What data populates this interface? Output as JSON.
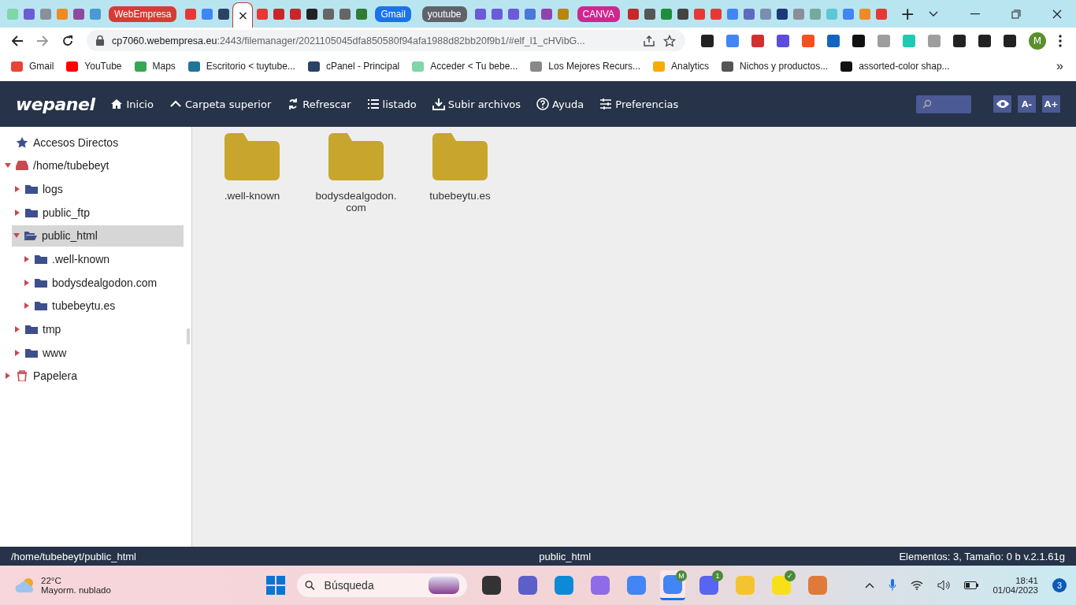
{
  "browser": {
    "tabs": [
      {
        "kind": "icon",
        "color": "#7fd6a6",
        "selected": false
      },
      {
        "kind": "icon",
        "color": "#6b5bd6",
        "selected": false
      },
      {
        "kind": "icon",
        "color": "#8a8f99",
        "selected": false
      },
      {
        "kind": "icon",
        "color": "#f08a24",
        "selected": false
      },
      {
        "kind": "icon",
        "color": "#8e4a9e",
        "selected": false
      },
      {
        "kind": "icon",
        "color": "#4a9ad6",
        "selected": false
      },
      {
        "kind": "label",
        "label": "WebEmpresa",
        "color": "#d93a35",
        "selected": false
      },
      {
        "kind": "icon",
        "color": "#e53935",
        "selected": false
      },
      {
        "kind": "icon",
        "color": "#4285f4",
        "selected": false
      },
      {
        "kind": "icon",
        "color": "#2b4266",
        "selected": false
      },
      {
        "kind": "close",
        "label": "×",
        "color": "#ffffff",
        "selected": true
      },
      {
        "kind": "icon",
        "color": "#e53935",
        "selected": false
      },
      {
        "kind": "icon",
        "color": "#c62828",
        "selected": false
      },
      {
        "kind": "icon",
        "color": "#c62828",
        "selected": false
      },
      {
        "kind": "icon",
        "color": "#222222",
        "selected": false
      },
      {
        "kind": "icon",
        "color": "#666666",
        "selected": false
      },
      {
        "kind": "icon",
        "color": "#666666",
        "selected": false
      },
      {
        "kind": "icon",
        "color": "#2e7d32",
        "selected": false
      },
      {
        "kind": "label",
        "label": "Gmail",
        "color": "#1a73e8",
        "selected": false
      },
      {
        "kind": "label",
        "label": "youtube",
        "color": "#5f6368",
        "selected": false
      },
      {
        "kind": "icon",
        "color": "#6b5bd6",
        "selected": false
      },
      {
        "kind": "icon",
        "color": "#6b5bd6",
        "selected": false
      },
      {
        "kind": "icon",
        "color": "#6b5bd6",
        "selected": false
      },
      {
        "kind": "icon",
        "color": "#4a78d6",
        "selected": false
      },
      {
        "kind": "icon",
        "color": "#8e44ad",
        "selected": false
      },
      {
        "kind": "icon",
        "color": "#b8860b",
        "selected": false
      },
      {
        "kind": "label",
        "label": "CANVA",
        "color": "#d0268f",
        "selected": false
      },
      {
        "kind": "icon",
        "color": "#c62828",
        "selected": false
      },
      {
        "kind": "icon",
        "color": "#555555",
        "selected": false
      },
      {
        "kind": "icon",
        "color": "#1e8e3e",
        "selected": false
      },
      {
        "kind": "icon",
        "color": "#444444",
        "selected": false
      },
      {
        "kind": "icon",
        "color": "#e53935",
        "selected": false
      },
      {
        "kind": "icon",
        "color": "#e53935",
        "selected": false
      },
      {
        "kind": "icon",
        "color": "#4285f4",
        "selected": false
      },
      {
        "kind": "icon",
        "color": "#5c6bc0",
        "selected": false
      },
      {
        "kind": "icon",
        "color": "#7a8fb0",
        "selected": false
      },
      {
        "kind": "icon",
        "color": "#1a3a7a",
        "selected": false
      },
      {
        "kind": "icon",
        "color": "#8a8f99",
        "selected": false
      },
      {
        "kind": "icon",
        "color": "#74aa9c",
        "selected": false
      },
      {
        "kind": "icon",
        "color": "#5cc8d6",
        "selected": false
      },
      {
        "kind": "icon",
        "color": "#4285f4",
        "selected": false
      },
      {
        "kind": "icon",
        "color": "#f08a24",
        "selected": false
      },
      {
        "kind": "icon",
        "color": "#e53935",
        "selected": false
      }
    ],
    "new_tab": "+",
    "address": {
      "host": "cp7060.webempresa.eu",
      "path": ":2443/filemanager/2021105045dfa850580f94afa1988d82bb20f9b1/#elf_l1_cHVibG..."
    },
    "extensions": [
      {
        "color": "#222222"
      },
      {
        "color": "#4285f4"
      },
      {
        "color": "#d32f2f"
      },
      {
        "color": "#5c4de0"
      },
      {
        "color": "#f4511e"
      },
      {
        "color": "#1565c0"
      },
      {
        "color": "#111111"
      },
      {
        "color": "#9e9e9e"
      },
      {
        "color": "#1ecbb0"
      },
      {
        "color": "#9e9e9e"
      },
      {
        "color": "#222222"
      },
      {
        "color": "#222222"
      },
      {
        "color": "#222222"
      }
    ],
    "profile": "M",
    "bookmarks": [
      {
        "label": "Gmail",
        "color": "#ea4335"
      },
      {
        "label": "YouTube",
        "color": "#ff0000"
      },
      {
        "label": "Maps",
        "color": "#34a853"
      },
      {
        "label": "Escritorio < tuytube...",
        "color": "#21759b"
      },
      {
        "label": "cPanel - Principal",
        "color": "#2b4266"
      },
      {
        "label": "Acceder < Tu bebe...",
        "color": "#7fd6a6"
      },
      {
        "label": "Los Mejores Recurs...",
        "color": "#888888"
      },
      {
        "label": "Analytics",
        "color": "#f9ab00"
      },
      {
        "label": "Nichos y productos...",
        "color": "#555555"
      },
      {
        "label": "assorted-color shap...",
        "color": "#111111"
      }
    ],
    "bookmarks_more": "»"
  },
  "app": {
    "logo": "wepanel",
    "toolbar": [
      {
        "kind": "home",
        "label": "Inicio"
      },
      {
        "kind": "up",
        "label": "Carpeta superior"
      },
      {
        "kind": "refresh",
        "label": "Refrescar"
      },
      {
        "kind": "list",
        "label": "listado"
      },
      {
        "kind": "upload",
        "label": "Subir archivos"
      },
      {
        "kind": "help",
        "label": "Ayuda"
      },
      {
        "kind": "prefs",
        "label": "Preferencias"
      }
    ],
    "font_buttons": [
      "A-",
      "A+"
    ],
    "tree": [
      {
        "kind": "star",
        "label": "Accesos Directos",
        "selected": false
      },
      {
        "kind": "drive",
        "label": "/home/tubebeyt",
        "expanded": true,
        "selected": false,
        "children": [
          {
            "kind": "folder",
            "label": "logs",
            "expanded": false,
            "selected": false
          },
          {
            "kind": "folder",
            "label": "public_ftp",
            "expanded": false,
            "selected": false
          },
          {
            "kind": "folder",
            "label": "public_html",
            "expanded": true,
            "selected": true,
            "children": [
              {
                "kind": "folder",
                "label": ".well-known",
                "expanded": false,
                "selected": false
              },
              {
                "kind": "folder",
                "label": "bodysdealgodon.com",
                "expanded": false,
                "selected": false
              },
              {
                "kind": "folder",
                "label": "tubebeytu.es",
                "expanded": false,
                "selected": false
              }
            ]
          },
          {
            "kind": "folder",
            "label": "tmp",
            "expanded": false,
            "selected": false
          },
          {
            "kind": "folder",
            "label": "www",
            "expanded": false,
            "selected": false
          }
        ]
      },
      {
        "kind": "trash",
        "label": "Papelera",
        "expanded": false,
        "selected": false
      }
    ],
    "files": [
      {
        "name": ".well-known"
      },
      {
        "name": "bodysdealgodon.com"
      },
      {
        "name": "tubebeytu.es"
      }
    ],
    "status_bar": {
      "path": "/home/tubebeyt/public_html",
      "current": "public_html",
      "info": "Elementos: 3, Tamaño: 0 b v.2.1.61g"
    }
  },
  "taskbar": {
    "weather": {
      "temp": "22°C",
      "condition": "Mayorm. nublado"
    },
    "search": {
      "placeholder": "Búsqueda"
    },
    "apps": [
      {
        "color": "#333333"
      },
      {
        "color": "#5b5fc7"
      },
      {
        "color": "#0c8ad6"
      },
      {
        "color": "#8f6be8"
      },
      {
        "color": "#4285f4"
      },
      {
        "color": "#4285f4",
        "badge": "M",
        "selected": true
      },
      {
        "color": "#5865f2",
        "badge": "1"
      },
      {
        "color": "#f4c430"
      },
      {
        "color": "#f7e017",
        "badge": "✓"
      },
      {
        "color": "#e07a3a"
      }
    ],
    "time": "18:41",
    "date": "01/04/2023",
    "notifications": "3"
  }
}
